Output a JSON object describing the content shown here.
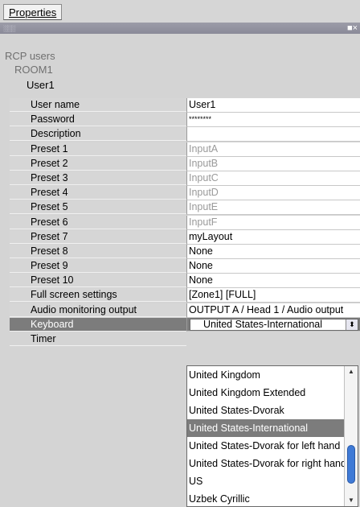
{
  "toolbar": {
    "properties_tab": "Properties"
  },
  "tree": {
    "level1": "RCP users",
    "level2": "ROOM1",
    "level3": "User1"
  },
  "properties": [
    {
      "label": "User name",
      "value": "User1",
      "dim": false
    },
    {
      "label": "Password",
      "value": "********",
      "dim": false
    },
    {
      "label": "Description",
      "value": "",
      "dim": false
    },
    {
      "label": "Preset 1",
      "value": "InputA",
      "dim": true
    },
    {
      "label": "Preset 2",
      "value": "InputB",
      "dim": true
    },
    {
      "label": "Preset 3",
      "value": "InputC",
      "dim": true
    },
    {
      "label": "Preset 4",
      "value": "InputD",
      "dim": true
    },
    {
      "label": "Preset 5",
      "value": "InputE",
      "dim": true
    },
    {
      "label": "Preset 6",
      "value": "InputF",
      "dim": true
    },
    {
      "label": "Preset 7",
      "value": "myLayout",
      "dim": false
    },
    {
      "label": "Preset 8",
      "value": "None",
      "dim": false
    },
    {
      "label": "Preset 9",
      "value": "None",
      "dim": false
    },
    {
      "label": "Preset 10",
      "value": "None",
      "dim": false
    },
    {
      "label": "Full screen settings",
      "value": "[Zone1] [FULL]",
      "dim": false
    },
    {
      "label": "Audio monitoring output",
      "value": "OUTPUT A / Head 1 / Audio output",
      "dim": false
    }
  ],
  "keyboard": {
    "label": "Keyboard",
    "selected": "United States-International"
  },
  "timer": {
    "label": "Timer"
  },
  "keyboard_options": [
    "United Kingdom",
    "United Kingdom Extended",
    "United States-Dvorak",
    "United States-International",
    "United States-Dvorak for left hand",
    "United States-Dvorak for right hand",
    "US",
    "Uzbek Cyrillic"
  ],
  "highlighted_index": 3,
  "colors": {
    "selected_row": "#7c7c7c",
    "scroll_thumb": "#3f7ad6",
    "titlebar": "#9494a2"
  }
}
